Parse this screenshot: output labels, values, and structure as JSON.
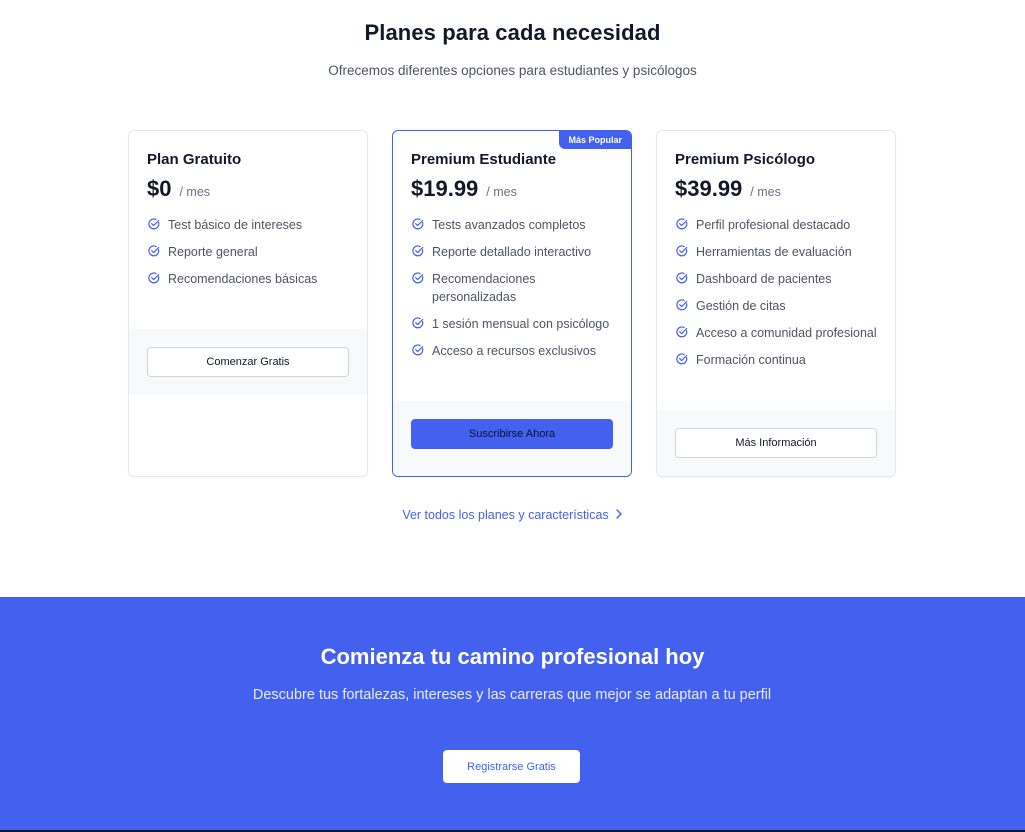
{
  "pricing": {
    "title": "Planes para cada necesidad",
    "subtitle": "Ofrecemos diferentes opciones para estudiantes y psicólogos",
    "accent_color": "#4361ee",
    "plans": [
      {
        "name": "Plan Gratuito",
        "price": "$0",
        "period": "/ mes",
        "features": [
          "Test básico de intereses",
          "Reporte general",
          "Recomendaciones básicas"
        ],
        "cta": "Comenzar Gratis"
      },
      {
        "name": "Premium Estudiante",
        "price": "$19.99",
        "period": "/ mes",
        "badge": "Más Popular",
        "features": [
          "Tests avanzados completos",
          "Reporte detallado interactivo",
          "Recomendaciones personalizadas",
          "1 sesión mensual con psicólogo",
          "Acceso a recursos exclusivos"
        ],
        "cta": "Suscribirse Ahora"
      },
      {
        "name": "Premium Psicólogo",
        "price": "$39.99",
        "period": "/ mes",
        "features": [
          "Perfil profesional destacado",
          "Herramientas de evaluación",
          "Dashboard de pacientes",
          "Gestión de citas",
          "Acceso a comunidad profesional",
          "Formación continua"
        ],
        "cta": "Más Información"
      }
    ],
    "all_plans_link": "Ver todos los planes y características",
    "link_icon": "chevron-right-icon",
    "feature_icon": "check-circle-icon"
  },
  "cta": {
    "title": "Comienza tu camino profesional hoy",
    "description": "Descubre tus fortalezas, intereses y las carreras que mejor se adaptan a tu perfil",
    "button": "Registrarse Gratis",
    "background_color": "#4361ee"
  }
}
